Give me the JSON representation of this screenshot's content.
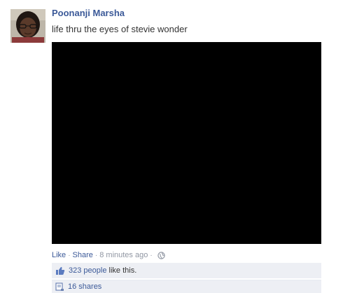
{
  "post": {
    "author": "Poonanji Marsha",
    "message": "life thru the eyes of stevie wonder",
    "actions": {
      "like": "Like",
      "separator": "·",
      "share": "Share",
      "timestamp": "8 minutes ago"
    },
    "likes": {
      "people_link": "323 people",
      "suffix": " like this."
    },
    "shares": {
      "label": "16 shares"
    }
  },
  "colors": {
    "link": "#3b5998",
    "meta": "#9197a3",
    "ufi_background": "#edeff4",
    "media": "#000000"
  },
  "icons": {
    "privacy": "globe-icon",
    "likes": "thumbs-up-icon",
    "shares": "share-icon"
  }
}
